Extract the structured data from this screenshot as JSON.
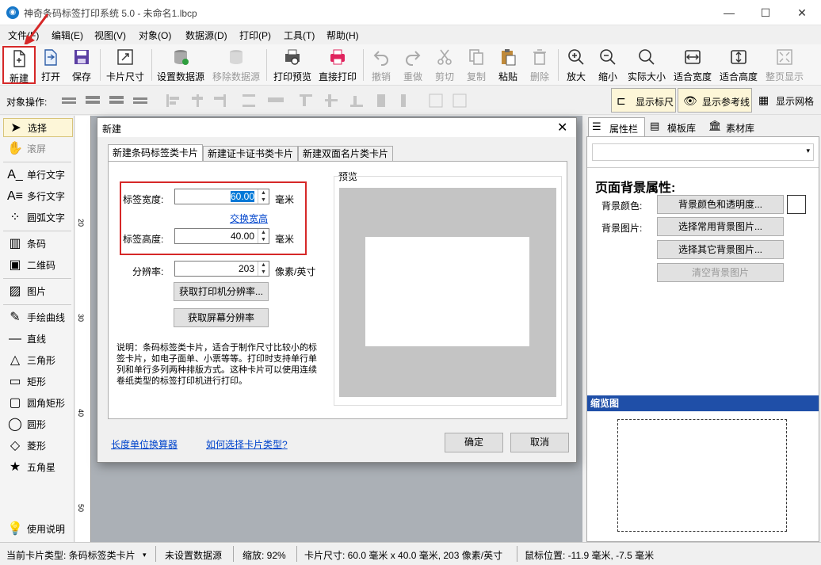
{
  "window": {
    "title": "神奇条码标签打印系统 5.0 - 未命名1.lbcp",
    "app_icon": "app-icon",
    "minimize": "—",
    "maximize": "☐",
    "close": "✕"
  },
  "menu": [
    "文件(F)",
    "编辑(E)",
    "视图(V)",
    "对象(O)",
    "数据源(D)",
    "打印(P)",
    "工具(T)",
    "帮助(H)"
  ],
  "toolbar": {
    "new": "新建",
    "open": "打开",
    "save": "保存",
    "card_size": "卡片尺寸",
    "set_datasource": "设置数据源",
    "remove_datasource": "移除数据源",
    "print_preview": "打印预览",
    "direct_print": "直接打印",
    "undo": "撤销",
    "redo": "重做",
    "cut": "剪切",
    "copy": "复制",
    "paste": "粘贴",
    "delete": "删除",
    "zoom_in": "放大",
    "zoom_out": "缩小",
    "actual_size": "实际大小",
    "fit_width": "适合宽度",
    "fit_height": "适合高度",
    "full_page": "整页显示"
  },
  "toolbar2": {
    "label": "对象操作:",
    "show_ruler": "显示标尺",
    "show_guides": "显示参考线",
    "show_grid": "显示网格"
  },
  "tools": {
    "select": "选择",
    "scroll": "滚屏",
    "single_text": "单行文字",
    "multi_text": "多行文字",
    "arc_text": "圆弧文字",
    "barcode": "条码",
    "qrcode": "二维码",
    "image": "图片",
    "freehand": "手绘曲线",
    "line": "直线",
    "triangle": "三角形",
    "rectangle": "矩形",
    "rounded_rect": "圆角矩形",
    "circle": "圆形",
    "diamond": "菱形",
    "star": "五角星",
    "help": "使用说明"
  },
  "ruler": [
    "20",
    "30",
    "40",
    "50"
  ],
  "rightpanel": {
    "tabs": [
      "属性栏",
      "模板库",
      "素材库"
    ],
    "section_title": "页面背景属性:",
    "bg_color_label": "背景颜色:",
    "bg_color_button": "背景颜色和透明度...",
    "bg_image_label": "背景图片:",
    "choose_common_bg": "选择常用背景图片...",
    "choose_other_bg": "选择其它背景图片...",
    "clear_bg": "清空背景图片",
    "thumbnail_header": "缩览图"
  },
  "dialog": {
    "title": "新建",
    "tabs": [
      "新建条码标签类卡片",
      "新建证卡证书类卡片",
      "新建双面名片类卡片"
    ],
    "width_label": "标签宽度:",
    "width_value": "60.00",
    "height_label": "标签高度:",
    "height_value": "40.00",
    "unit_mm": "毫米",
    "swap_link": "交换宽高",
    "dpi_label": "分辨率:",
    "dpi_value": "203",
    "dpi_unit": "像素/英寸",
    "get_printer_dpi": "获取打印机分辨率...",
    "get_screen_dpi": "获取屏幕分辨率",
    "description": "说明：条码标签类卡片，适合于制作尺寸比较小的标签卡片，如电子面单、小票等等。打印时支持单行单列和单行多列两种排版方式。这种卡片可以使用连续卷纸类型的标签打印机进行打印。",
    "preview_label": "预览",
    "unit_calc_link": "长度单位换算器",
    "how_choose_link": "如何选择卡片类型?",
    "ok": "确定",
    "cancel": "取消"
  },
  "status": {
    "card_type": "当前卡片类型: 条码标签类卡片",
    "datasource": "未设置数据源",
    "zoom": "缩放: 92%",
    "card_size": "卡片尺寸: 60.0 毫米 x 40.0 毫米, 203 像素/英寸",
    "mouse_pos": "鼠标位置: -11.9 毫米, -7.5 毫米"
  },
  "colors": {
    "highlight": "#d62828",
    "accent_blue": "#1f4fa8",
    "link": "#0044cc",
    "canvas_bg": "#abb0b6"
  }
}
